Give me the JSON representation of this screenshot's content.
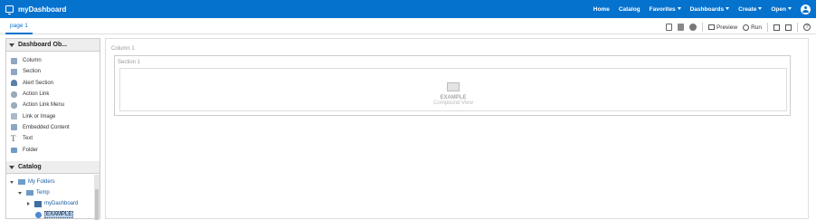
{
  "header": {
    "title": "myDashboard",
    "nav": [
      "Home",
      "Catalog",
      "Favorites",
      "Dashboards",
      "Create",
      "Open"
    ]
  },
  "tabs": [
    "page 1"
  ],
  "toolbar": {
    "preview": "Preview",
    "run": "Run",
    "help": "?"
  },
  "objects_panel": {
    "title": "Dashboard Ob...",
    "items": [
      {
        "label": "Column"
      },
      {
        "label": "Section"
      },
      {
        "label": "Alert Section"
      },
      {
        "label": "Action Link"
      },
      {
        "label": "Action Link Menu"
      },
      {
        "label": "Link or Image"
      },
      {
        "label": "Embedded Content"
      },
      {
        "label": "Text"
      },
      {
        "label": "Folder"
      }
    ]
  },
  "catalog_panel": {
    "title": "Catalog",
    "tree": [
      {
        "label": "My Folders"
      },
      {
        "label": "Temp"
      },
      {
        "label": "myDashboard"
      },
      {
        "label": "EXAMPLE"
      }
    ]
  },
  "canvas": {
    "column_label": "Column 1",
    "section_label": "Section 1",
    "view_title": "EXAMPLE",
    "view_type": "Compound View"
  }
}
